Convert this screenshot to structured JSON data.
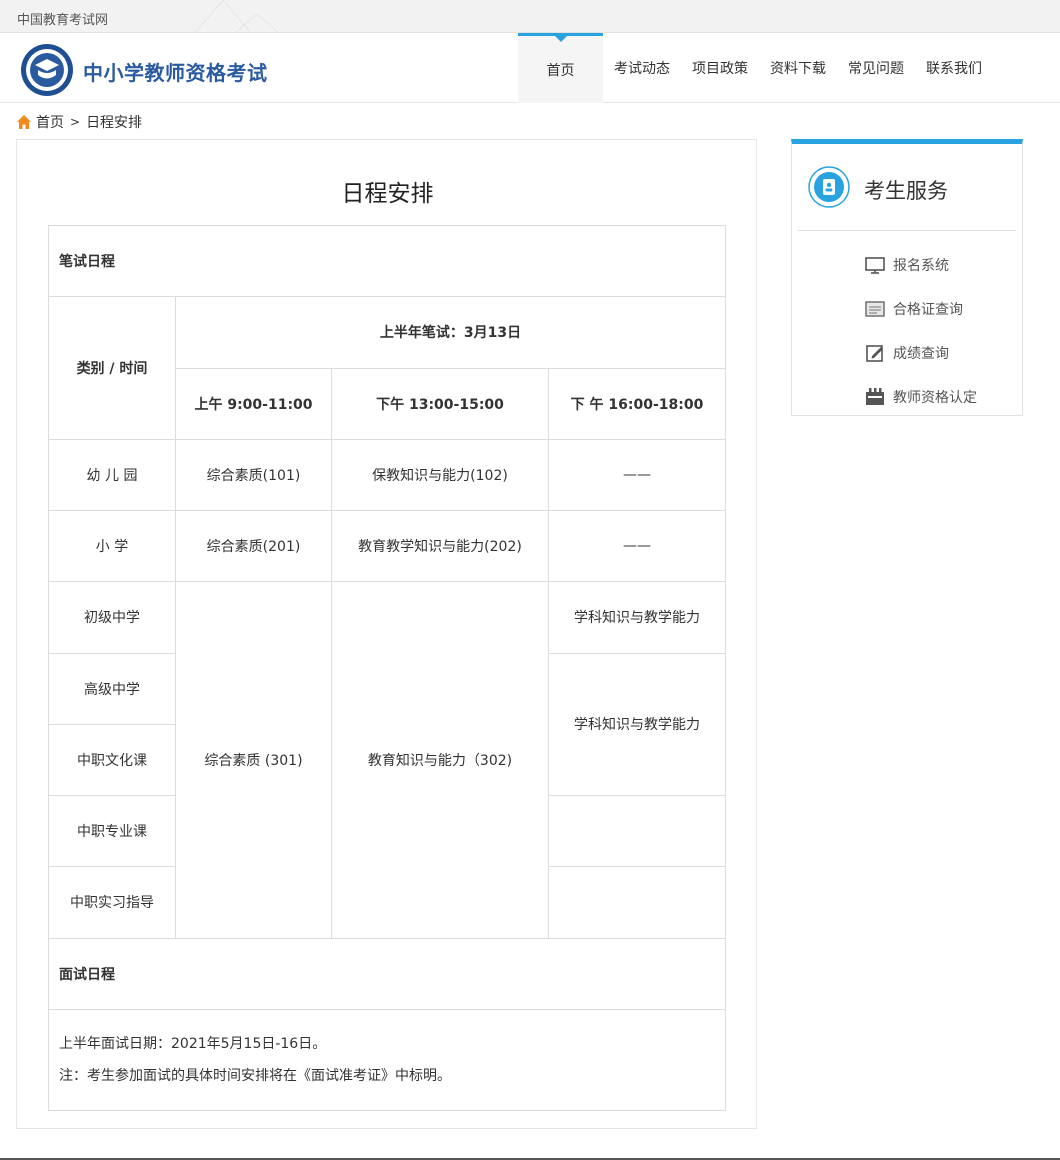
{
  "topbar": {
    "site_name": "中国教育考试网"
  },
  "header": {
    "brand": "中小学教师资格考试",
    "nav": [
      {
        "label": "首页",
        "active": true
      },
      {
        "label": "考试动态"
      },
      {
        "label": "项目政策"
      },
      {
        "label": "资料下载"
      },
      {
        "label": "常见问题"
      },
      {
        "label": "联系我们"
      }
    ]
  },
  "breadcrumb": {
    "home": "首页",
    "separator": ">",
    "current": "日程安排"
  },
  "main": {
    "title": "日程安排",
    "written_section": "笔试日程",
    "category_header": "类别 /  时间",
    "written_date": "上半年笔试：3月13日",
    "sessions": [
      "上午  9:00-11:00",
      "下午  13:00-15:00",
      "下 午  16:00-18:00"
    ],
    "rows": [
      {
        "category": "幼 儿 园",
        "s1": "综合素质(101)",
        "s2": "保教知识与能力(102)",
        "s3": "——"
      },
      {
        "category": "小    学",
        "s1": "综合素质(201)",
        "s2": "教育教学知识与能力(202)",
        "s3": "——"
      },
      {
        "category": "初级中学"
      },
      {
        "category": "高级中学"
      },
      {
        "category": "中职文化课"
      },
      {
        "category": "中职专业课"
      },
      {
        "category": "中职实习指导"
      }
    ],
    "merged_s1": "综合素质 (301)",
    "merged_s2": "教育知识与能力（302)",
    "middle_s3": "学科知识与教学能力",
    "high_s3": "学科知识与教学能力",
    "interview_section": "面试日程",
    "interview_date": "上半年面试日期：2021年5月15日-16日。",
    "interview_note": "注：考生参加面试的具体时间安排将在《面试准考证》中标明。"
  },
  "sidebar": {
    "title": "考生服务",
    "links": [
      {
        "label": "报名系统",
        "icon": "monitor-icon"
      },
      {
        "label": "合格证查询",
        "icon": "certificate-icon"
      },
      {
        "label": "成绩查询",
        "icon": "edit-icon"
      },
      {
        "label": "教师资格认定",
        "icon": "calendar-icon"
      }
    ]
  },
  "colors": {
    "accent": "#29a3e0",
    "brand": "#2a5aa0",
    "border": "#dcdcdc"
  }
}
